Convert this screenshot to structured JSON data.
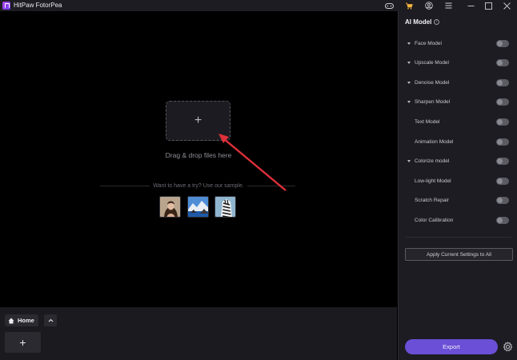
{
  "window": {
    "title": "HitPaw FotorPea",
    "icons": [
      "app-logo",
      "game-controller-icon",
      "cart-icon",
      "user-icon",
      "menu-icon",
      "minimize-icon",
      "maximize-icon",
      "close-icon"
    ]
  },
  "canvas": {
    "drop_plus": "+",
    "drop_text": "Drag & drop files here",
    "try_text": "Want to have a try? Use our sample.",
    "samples": [
      "portrait-sample",
      "mountain-lake-sample",
      "zebra-sample"
    ]
  },
  "bottom": {
    "home_label": "Home",
    "add_label": "+"
  },
  "panel": {
    "title": "AI Model",
    "models": [
      {
        "label": "Face Model",
        "expandable": true,
        "enabled": false
      },
      {
        "label": "Upscale Model",
        "expandable": true,
        "enabled": false
      },
      {
        "label": "Denoise Model",
        "expandable": true,
        "enabled": false
      },
      {
        "label": "Sharpen Model",
        "expandable": true,
        "enabled": false
      },
      {
        "label": "Text Model",
        "expandable": false,
        "enabled": false
      },
      {
        "label": "Animation Model",
        "expandable": false,
        "enabled": false
      },
      {
        "label": "Colorize model",
        "expandable": true,
        "enabled": false
      },
      {
        "label": "Low-light Model",
        "expandable": false,
        "enabled": false
      },
      {
        "label": "Scratch Repair",
        "expandable": false,
        "enabled": false
      },
      {
        "label": "Color Calibration",
        "expandable": false,
        "enabled": false
      }
    ],
    "apply_label": "Apply Current Settings to All",
    "export_label": "Export"
  },
  "colors": {
    "accent": "#6b4fd6",
    "arrow": "#e0303a",
    "panel_bg": "#1d1c22",
    "canvas_bg": "#000000"
  }
}
